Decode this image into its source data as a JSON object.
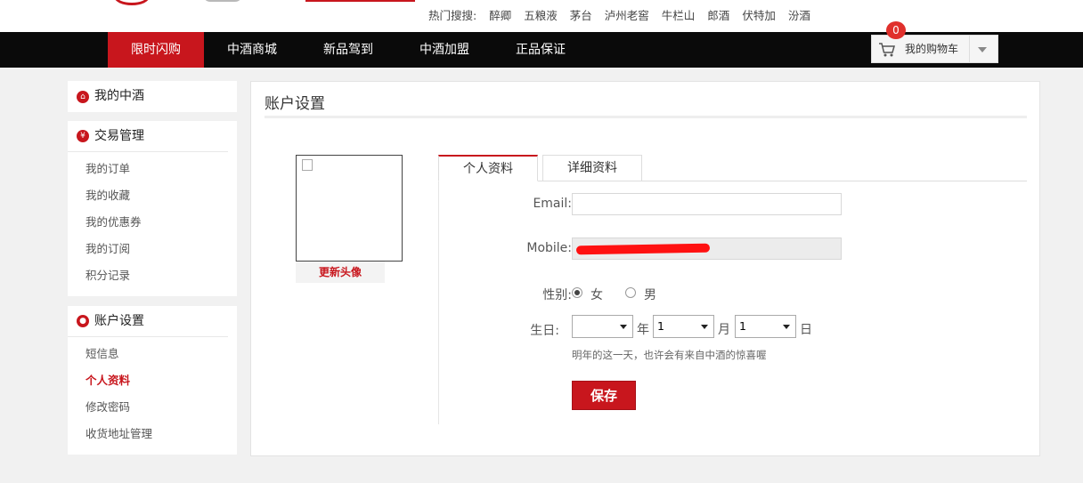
{
  "top": {
    "hot_label": "热门搜搜:",
    "hot_keywords": [
      "醉卿",
      "五粮液",
      "茅台",
      "泸州老窖",
      "牛栏山",
      "郎酒",
      "伏特加",
      "汾酒"
    ]
  },
  "nav": {
    "items": [
      {
        "label": "限时闪购",
        "active": true
      },
      {
        "label": "中酒商城",
        "active": false
      },
      {
        "label": "新品驾到",
        "active": false
      },
      {
        "label": "中酒加盟",
        "active": false
      },
      {
        "label": "正品保证",
        "active": false
      }
    ],
    "cart_label": "我的购物车",
    "cart_count": "0"
  },
  "sidebar": {
    "my_title": "我的中酒",
    "trade": {
      "title": "交易管理",
      "links": [
        "我的订单",
        "我的收藏",
        "我的优惠券",
        "我的订阅",
        "积分记录"
      ]
    },
    "account": {
      "title": "账户设置",
      "links": [
        "短信息",
        "个人资料",
        "修改密码",
        "收货地址管理"
      ],
      "current": "个人资料"
    }
  },
  "main": {
    "title": "账户设置",
    "avatar_button": "更新头像",
    "tabs": [
      "个人资料",
      "详细资料"
    ],
    "active_tab": "个人资料",
    "form": {
      "email_label": "Email:",
      "email_value": "",
      "mobile_label": "Mobile:",
      "gender_label": "性别:",
      "gender_options": [
        "女",
        "男"
      ],
      "gender_selected": "女",
      "birthday_label": "生日:",
      "year_value": "",
      "year_unit": "年",
      "month_value": "1",
      "month_unit": "月",
      "day_value": "1",
      "day_unit": "日",
      "birthday_hint": "明年的这一天，也许会有来自中酒的惊喜喔",
      "save_label": "保存"
    }
  },
  "colors": {
    "brand_red": "#c8161d",
    "nav_bg": "#0a0a0a",
    "page_bg": "#f1f1f1"
  }
}
